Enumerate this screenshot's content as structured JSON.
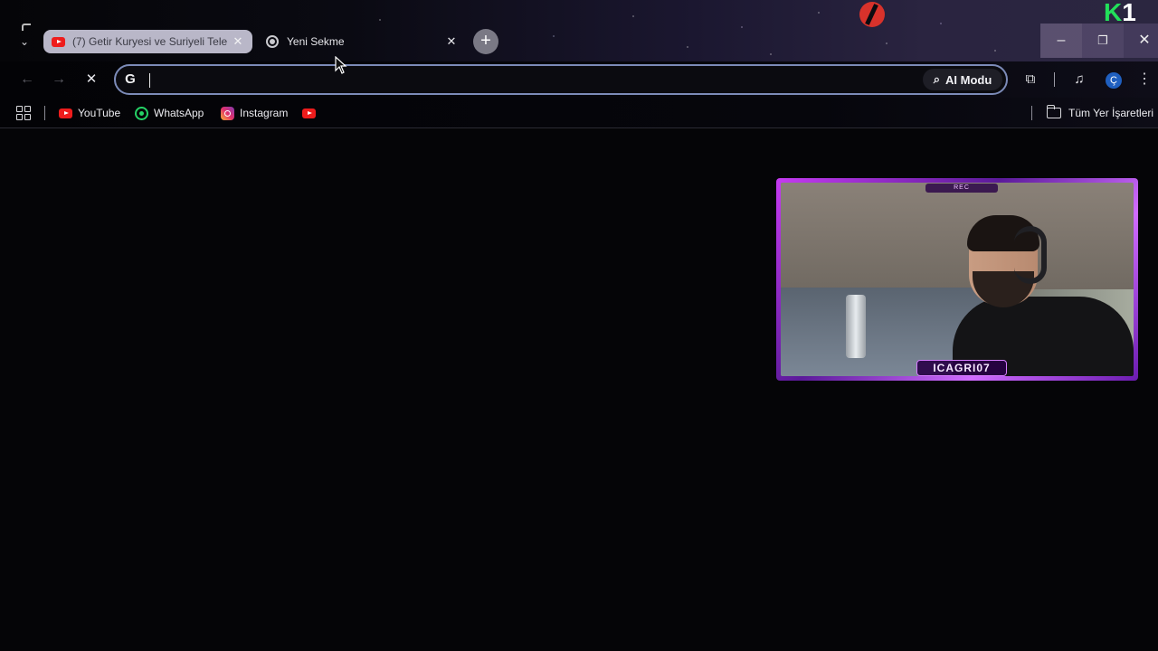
{
  "tabs": [
    {
      "title": "(7) Getir Kuryesi ve Suriyeli Tele",
      "favicon": "youtube-icon",
      "active": true,
      "close": "✕"
    },
    {
      "title": "Yeni Sekme",
      "favicon": "chrome-icon",
      "active": false,
      "close": "✕"
    }
  ],
  "new_tab_label": "+",
  "window_controls": {
    "minimize": "–",
    "maximize": "❐",
    "close": "✕"
  },
  "overlay": {
    "k1_letter": "K",
    "k1_digit": "1"
  },
  "toolbar": {
    "back": "←",
    "forward": "→",
    "stop": "✕",
    "search_engine": "G",
    "address_value": "",
    "ai_mode_label": "AI Modu",
    "extensions": "⧉",
    "media": "♫",
    "profile_initial": "Ç",
    "menu": "⋮"
  },
  "bookmarks": {
    "items": [
      {
        "label": "YouTube",
        "icon": "youtube-icon"
      },
      {
        "label": "WhatsApp",
        "icon": "whatsapp-icon"
      },
      {
        "label": "Instagram",
        "icon": "instagram-icon"
      },
      {
        "label": "",
        "icon": "youtube-icon"
      }
    ],
    "all_bookmarks_label": "Tüm Yer İşaretleri"
  },
  "webcam": {
    "name_tag": "ICAGRI07",
    "top_tag": "REC"
  },
  "colors": {
    "accent": "#7c8bb8",
    "youtube": "#ee1c1c",
    "whatsapp": "#25d366",
    "webcam_frame": "#c63bf2"
  }
}
